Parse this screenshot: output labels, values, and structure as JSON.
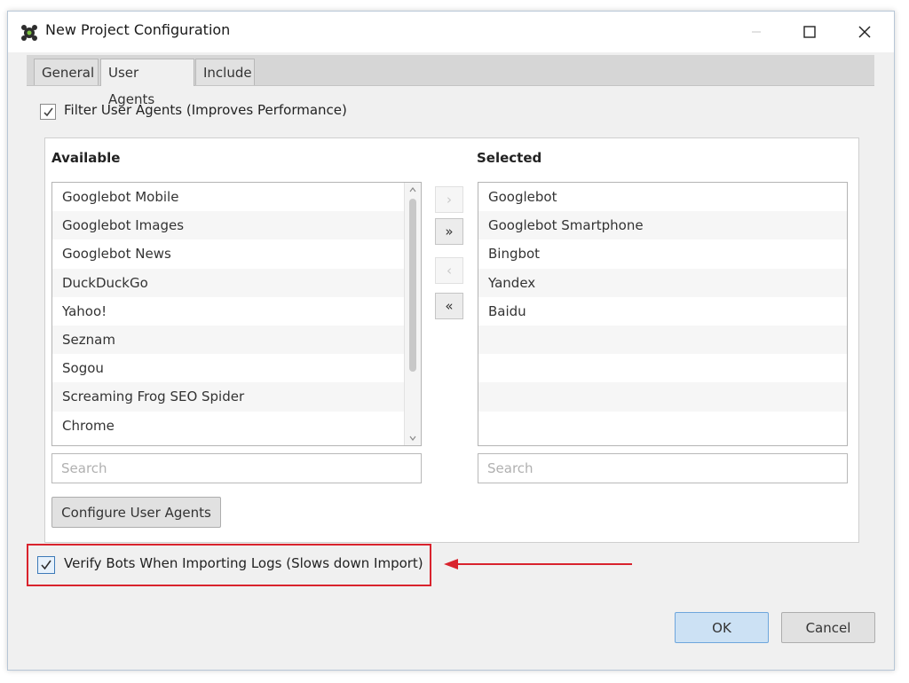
{
  "window": {
    "title": "New Project Configuration",
    "minimize_icon": "minimize-icon",
    "maximize_icon": "maximize-icon",
    "close_icon": "close-icon"
  },
  "tabs": [
    {
      "label": "General",
      "active": false
    },
    {
      "label": "User Agents",
      "active": true
    },
    {
      "label": "Include",
      "active": false
    }
  ],
  "filter_checkbox": {
    "label": "Filter User Agents (Improves Performance)",
    "checked": true
  },
  "available": {
    "heading": "Available",
    "items": [
      "Googlebot Mobile",
      "Googlebot Images",
      "Googlebot News",
      "DuckDuckGo",
      "Yahoo!",
      "Seznam",
      "Sogou",
      "Screaming Frog SEO Spider",
      "Chrome"
    ],
    "search_placeholder": "Search"
  },
  "selected": {
    "heading": "Selected",
    "items": [
      "Googlebot",
      "Googlebot Smartphone",
      "Bingbot",
      "Yandex",
      "Baidu"
    ],
    "search_placeholder": "Search"
  },
  "move_buttons": {
    "add": "›",
    "add_all": "»",
    "remove": "‹",
    "remove_all": "«"
  },
  "configure_button": "Configure User Agents",
  "verify_checkbox": {
    "label": "Verify Bots When Importing Logs (Slows down Import)",
    "checked": true
  },
  "footer": {
    "ok": "OK",
    "cancel": "Cancel"
  },
  "colors": {
    "highlight": "#d9232d",
    "accent": "#cce1f4"
  }
}
